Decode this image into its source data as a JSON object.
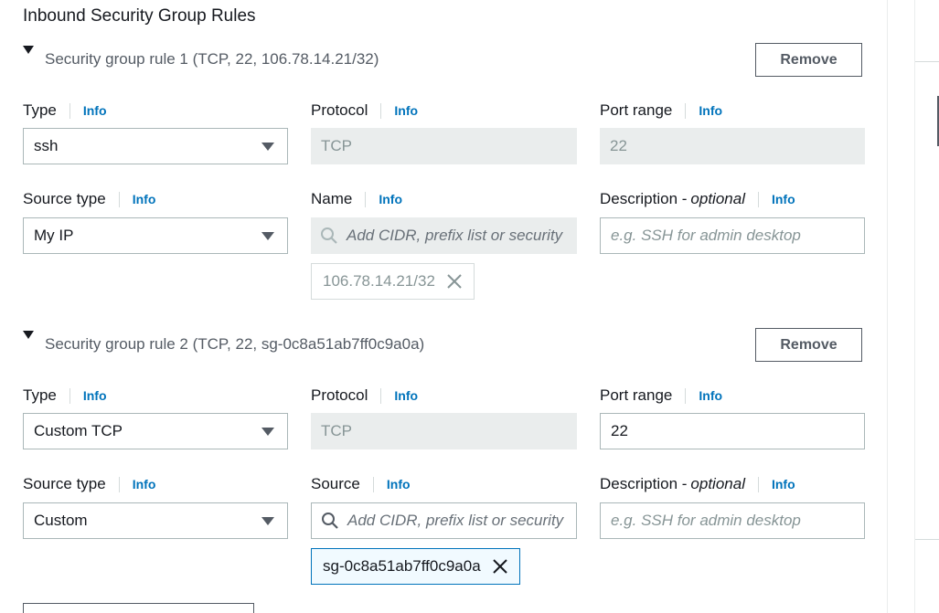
{
  "title": "Inbound Security Group Rules",
  "info_label": "Info",
  "remove_label": "Remove",
  "rules": [
    {
      "heading": "Security group rule 1 (TCP, 22, 106.78.14.21/32)",
      "type_label": "Type",
      "type_value": "ssh",
      "protocol_label": "Protocol",
      "protocol_value": "TCP",
      "port_label": "Port range",
      "port_value": "22",
      "source_type_label": "Source type",
      "source_type_value": "My IP",
      "source_label": "Name",
      "source_placeholder": "Add CIDR, prefix list or security",
      "source_token": "106.78.14.21/32",
      "description_label": "Description - ",
      "description_optional": "optional",
      "description_placeholder": "e.g. SSH for admin desktop"
    },
    {
      "heading": "Security group rule 2 (TCP, 22, sg-0c8a51ab7ff0c9a0a)",
      "type_label": "Type",
      "type_value": "Custom TCP",
      "protocol_label": "Protocol",
      "protocol_value": "TCP",
      "port_label": "Port range",
      "port_value": "22",
      "source_type_label": "Source type",
      "source_type_value": "Custom",
      "source_label": "Source",
      "source_placeholder": "Add CIDR, prefix list or security",
      "source_token": "sg-0c8a51ab7ff0c9a0a",
      "description_label": "Description - ",
      "description_optional": "optional",
      "description_placeholder": "e.g. SSH for admin desktop"
    }
  ],
  "icons": {
    "expand": "caret-down-icon",
    "dropdown": "chevron-down-icon",
    "search": "search-icon",
    "dismiss": "close-icon"
  },
  "colors": {
    "link": "#0073bb",
    "border": "#aab7b8",
    "disabled_bg": "#eaeded",
    "token_bg": "#f1faff"
  }
}
